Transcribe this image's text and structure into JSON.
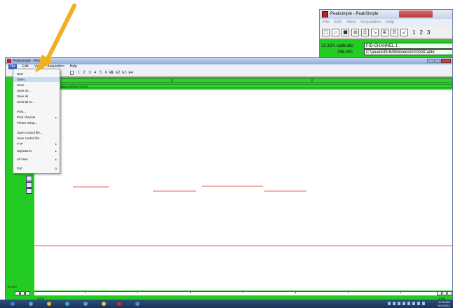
{
  "inset": {
    "title": "Peaksimple - PeakSimple",
    "menu": [
      "File",
      "Edit",
      "View",
      "Acquisition",
      "Help"
    ],
    "toolbar_icons": [
      "new-file-icon",
      "open-folder-icon",
      "save-icon",
      "color-icon",
      "print-icon",
      "draw-icon",
      "list-icon",
      "align-icon",
      "chart-icon"
    ],
    "channel_numbers": [
      "1",
      "2",
      "3"
    ],
    "status_percent": "13.32% calibratio",
    "channel_name": "FID-CHANNEL 1",
    "value": "256.000",
    "file_path": "C:\\peak449-64b\\Model420\\333Calibr"
  },
  "window": {
    "title": "Peaksimple - Pea",
    "menu": [
      "File",
      "Edit",
      "View",
      "Acquisition",
      "Help"
    ],
    "toolbar_numbers": [
      "1",
      "2",
      "3",
      "4",
      "5",
      "6",
      "8"
    ],
    "toolbar_big": [
      "E1",
      "E2",
      "E3",
      "E4"
    ],
    "path_text": "Model420\\333Calibration\\DEFAULT.CON",
    "y_min_label": "-64.000",
    "x_start_label": "0.000",
    "x_end_label": "4.000"
  },
  "file_menu": {
    "items": [
      {
        "label": "New",
        "arrow": false,
        "highlighted": false
      },
      {
        "label": "Open...",
        "arrow": false,
        "highlighted": true
      },
      {
        "label": "Save",
        "arrow": false,
        "highlighted": false
      },
      {
        "label": "Save as...",
        "arrow": false,
        "highlighted": false
      },
      {
        "label": "Save all",
        "arrow": false,
        "highlighted": false
      },
      {
        "label": "Send all to...",
        "arrow": false,
        "highlighted": false
      },
      {
        "label": "Print...",
        "arrow": false,
        "highlighted": false
      },
      {
        "label": "Print channel",
        "arrow": true,
        "highlighted": false
      },
      {
        "label": "Printer setup...",
        "arrow": false,
        "highlighted": false
      },
      {
        "label": "Open control file...",
        "arrow": false,
        "highlighted": false
      },
      {
        "label": "Save control file...",
        "arrow": false,
        "highlighted": false
      },
      {
        "label": "FTP",
        "arrow": true,
        "highlighted": false
      },
      {
        "label": "Signatures",
        "arrow": true,
        "highlighted": false
      },
      {
        "label": "Alt New",
        "arrow": true,
        "highlighted": false
      },
      {
        "label": "Exit",
        "arrow": false,
        "highlighted": false
      }
    ],
    "exit_shortcut": "Q"
  },
  "taskbar": {
    "apps": [
      {
        "icon": "start-orb-icon",
        "color": "#3a7fd0"
      },
      {
        "icon": "browser-icon",
        "color": "#4aa3e8"
      },
      {
        "icon": "explorer-icon",
        "color": "#e6b53a"
      },
      {
        "icon": "app-icon",
        "color": "#3fa3d8"
      },
      {
        "icon": "photo-icon",
        "color": "#5aa0e0"
      },
      {
        "icon": "folder-icon",
        "color": "#e8c25a"
      },
      {
        "icon": "peaksimple-icon",
        "color": "#c23030"
      },
      {
        "icon": "chart-app-icon",
        "color": "#4a8ad4"
      }
    ],
    "time": "11:26 AM",
    "date": "6/11/2014"
  },
  "colors": {
    "channel_green": "#22cc22",
    "trace_red": "#e06060",
    "arrow_orange": "#f0b020"
  }
}
